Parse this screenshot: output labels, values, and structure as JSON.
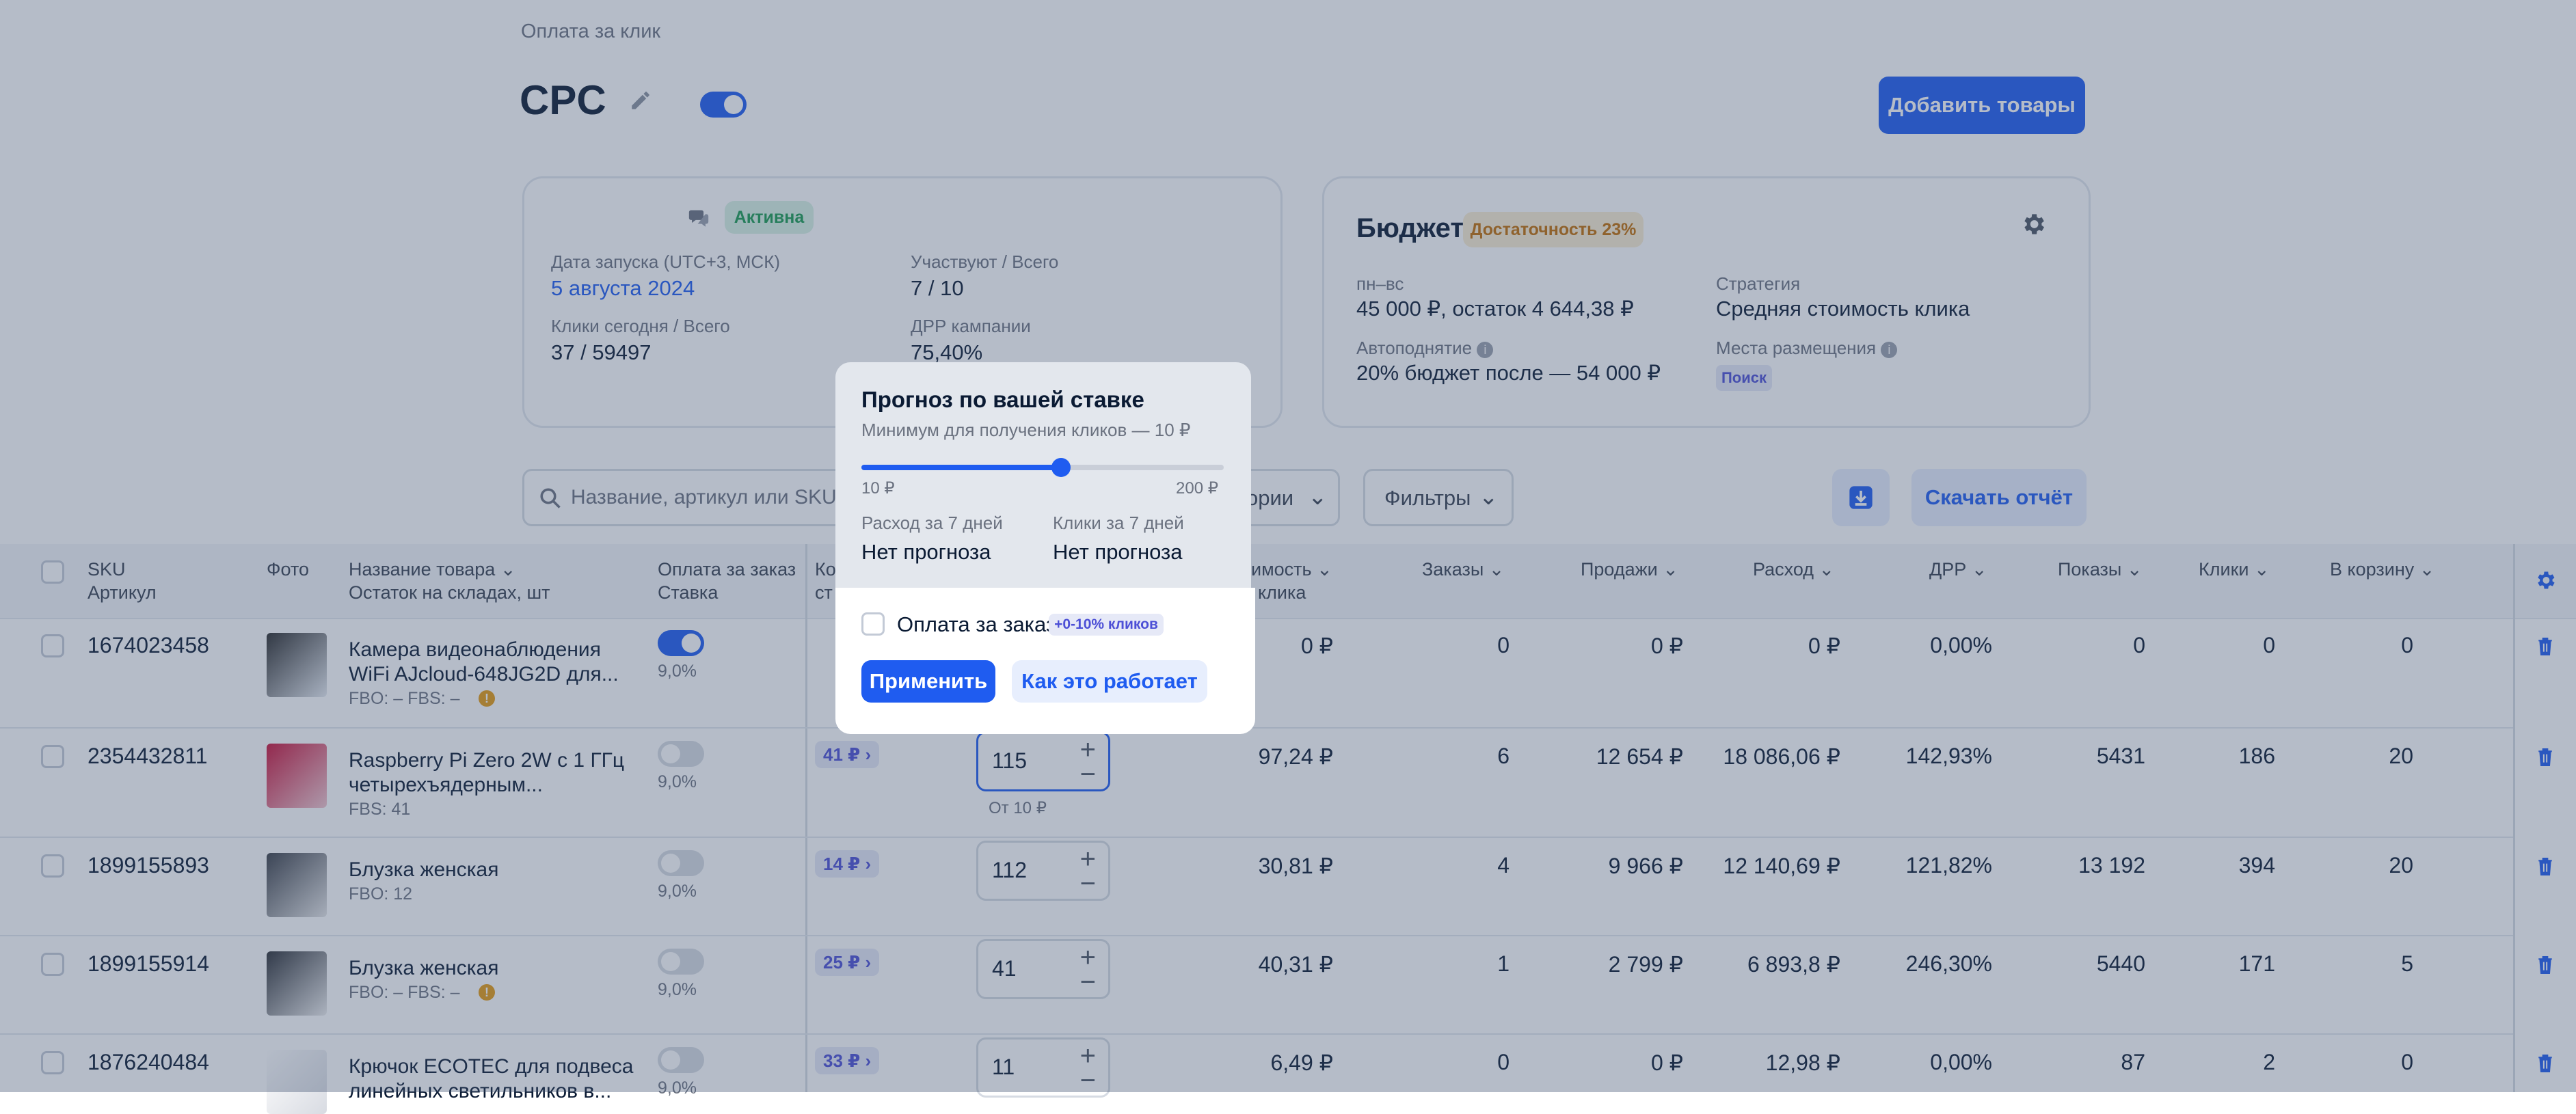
{
  "breadcrumb": "Оплата за клик",
  "campaign": {
    "title": "CPC",
    "enabled": true
  },
  "add_products_label": "Добавить товары",
  "info_card": {
    "status": "Активна",
    "launch_label": "Дата запуска (UTC+3, МСК)",
    "launch_value": "5 августа 2024",
    "participants_label": "Участвуют / Всего",
    "participants_value": "7 / 10",
    "clicks_label": "Клики сегодня / Всего",
    "clicks_value": "37 / 59497",
    "drr_label": "ДРР кампании",
    "drr_value": "75,40%"
  },
  "budget_card": {
    "title": "Бюджет",
    "sufficiency": "Достаточность 23%",
    "period_label": "пн–вс",
    "period_value": "45 000 ₽, остаток 4 644,38 ₽",
    "strategy_label": "Стратегия",
    "strategy_value": "Средняя стоимость клика",
    "autoraise_label": "Автоподнятие",
    "autoraise_value": "20% бюджет после — 54 000 ₽",
    "placements_label": "Места размещения",
    "placement_tag": "Поиск"
  },
  "toolbar": {
    "search_placeholder": "Название, артикул или SKU",
    "categories_label": "ории",
    "filters_label": "Фильтры",
    "download_report_label": "Скачать отчёт"
  },
  "table": {
    "headers": {
      "sku": "SKU",
      "sku_sub": "Артикул",
      "photo": "Фото",
      "name": "Название товара",
      "name_sub": "Остаток на складах, шт",
      "pay": "Оплата за заказ",
      "pay_sub": "Ставка",
      "ko": "Ко",
      "st": "ст",
      "cost": "имость",
      "cost_sub": "клика",
      "orders": "Заказы",
      "sales": "Продажи",
      "spend": "Расход",
      "drr": "ДРР",
      "views": "Показы",
      "clicks": "Клики",
      "cart": "В корзину"
    },
    "rows": [
      {
        "sku": "1674023458",
        "name1": "Камера видеонаблюдения",
        "name2": "WiFi AJcloud-648JG2D для...",
        "stock": "FBO: –   FBS: –",
        "warn": true,
        "pay_on": true,
        "rate": "9,0%",
        "pill": "",
        "bid": "",
        "bid_hint": "",
        "cost": "0 ₽",
        "orders": "0",
        "sales": "0 ₽",
        "spend": "0 ₽",
        "drr": "0,00%",
        "views": "0",
        "clicks": "0",
        "cart": "0"
      },
      {
        "sku": "2354432811",
        "name1": "Raspberry Pi Zero 2W с 1 ГГц",
        "name2": "четырехъядерным...",
        "stock": "FBS: 41",
        "warn": false,
        "pay_on": false,
        "rate": "9,0%",
        "pill": "41 ₽ ›",
        "bid": "115",
        "bid_hint": "От 10 ₽",
        "cost": "97,24 ₽",
        "orders": "6",
        "sales": "12 654 ₽",
        "spend": "18 086,06 ₽",
        "drr": "142,93%",
        "views": "5431",
        "clicks": "186",
        "cart": "20"
      },
      {
        "sku": "1899155893",
        "name1": "Блузка женская",
        "name2": "",
        "stock": "FBO: 12",
        "warn": false,
        "pay_on": false,
        "rate": "9,0%",
        "pill": "14 ₽ ›",
        "bid": "112",
        "bid_hint": "",
        "cost": "30,81 ₽",
        "orders": "4",
        "sales": "9 966 ₽",
        "spend": "12 140,69 ₽",
        "drr": "121,82%",
        "views": "13 192",
        "clicks": "394",
        "cart": "20"
      },
      {
        "sku": "1899155914",
        "name1": "Блузка женская",
        "name2": "",
        "stock": "FBO: –   FBS: –",
        "warn": true,
        "pay_on": false,
        "rate": "9,0%",
        "pill": "25 ₽ ›",
        "bid": "41",
        "bid_hint": "",
        "cost": "40,31 ₽",
        "orders": "1",
        "sales": "2 799 ₽",
        "spend": "6 893,8 ₽",
        "drr": "246,30%",
        "views": "5440",
        "clicks": "171",
        "cart": "5"
      },
      {
        "sku": "1876240484",
        "name1": "Крючок ECOTEC для подвеса",
        "name2": "линейных светильников в...",
        "stock": "",
        "warn": false,
        "pay_on": false,
        "rate": "9,0%",
        "pill": "33 ₽ ›",
        "bid": "11",
        "bid_hint": "",
        "cost": "6,49 ₽",
        "orders": "0",
        "sales": "0 ₽",
        "spend": "12,98 ₽",
        "drr": "0,00%",
        "views": "87",
        "clicks": "2",
        "cart": "0"
      }
    ]
  },
  "popup": {
    "title": "Прогноз по вашей ставке",
    "subtitle": "Минимум для получения кликов — 10 ₽",
    "slider_min": "10 ₽",
    "slider_max": "200 ₽",
    "slider_level": 0.55,
    "spend_label": "Расход за 7 дней",
    "spend_value": "Нет прогноза",
    "clicks_label": "Клики за 7 дней",
    "clicks_value": "Нет прогноза",
    "pay_per_order_label": "Оплата за заказ",
    "pay_per_order_tag": "+0-10% кликов",
    "apply_label": "Применить",
    "how_label": "Как это работает"
  },
  "colors": {
    "accent": "#1f5cf0",
    "success": "#1a9b52",
    "warning": "#e59b12"
  }
}
